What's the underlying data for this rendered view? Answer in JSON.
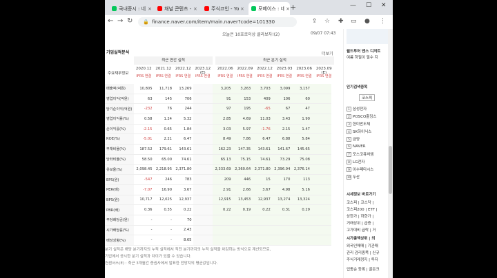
{
  "tabs": [
    {
      "title": "국내증시 : 네",
      "color": "#03c75a",
      "active": false
    },
    {
      "title": "채널 콘텐츠 -",
      "color": "#ff0000",
      "active": false
    },
    {
      "title": "주식코인 - Yo",
      "color": "#ff0000",
      "active": false
    },
    {
      "title": "모베이스 : 네",
      "color": "#03c75a",
      "active": true
    }
  ],
  "address": {
    "url": "finance.naver.com/item/main.naver?code=101330"
  },
  "ticker_bar": {
    "text": "오늘은 10호로이상 클라보자!(2)",
    "time": "09/07 07:43"
  },
  "section": {
    "title": "기업실적분석",
    "more": "더보기"
  },
  "table": {
    "header_main": "주요재무정보",
    "annual_title": "최근 연간 실적",
    "quarter_title": "최근 분기 실적",
    "annual_cols": [
      "2020.12",
      "2021.12",
      "2022.12",
      "2023.12 (E)"
    ],
    "quarter_cols": [
      "2022.06",
      "2022.09",
      "2022.12",
      "2023.03",
      "2023.06",
      "2023.09 (E)"
    ],
    "ifrs_label": "IFRS 연결",
    "rows": [
      {
        "label": "매출액(억원)",
        "a": [
          "10,805",
          "11,718",
          "13,269",
          ""
        ],
        "q": [
          "3,205",
          "3,263",
          "3,703",
          "3,099",
          "3,157",
          ""
        ]
      },
      {
        "label": "영업이익(억원)",
        "a": [
          "63",
          "145",
          "706",
          ""
        ],
        "q": [
          "91",
          "153",
          "409",
          "106",
          "60",
          ""
        ]
      },
      {
        "label": "당기순이익(억원)",
        "a": [
          "-232",
          "76",
          "244",
          ""
        ],
        "q": [
          "97",
          "195",
          "-65",
          "67",
          "47",
          ""
        ]
      },
      {
        "label": "영업이익률(%)",
        "a": [
          "0.58",
          "1.24",
          "5.32",
          ""
        ],
        "q": [
          "2.85",
          "4.69",
          "11.03",
          "3.43",
          "1.90",
          ""
        ]
      },
      {
        "label": "순이익률(%)",
        "a": [
          "-2.15",
          "0.65",
          "1.84",
          ""
        ],
        "q": [
          "3.03",
          "5.97",
          "-1.76",
          "2.15",
          "1.47",
          ""
        ]
      },
      {
        "label": "ROE(%)",
        "a": [
          "-5.01",
          "2.21",
          "6.47",
          ""
        ],
        "q": [
          "8.49",
          "7.86",
          "6.47",
          "6.88",
          "5.84",
          ""
        ]
      },
      {
        "label": "부채비율(%)",
        "a": [
          "187.52",
          "179.61",
          "143.61",
          ""
        ],
        "q": [
          "162.23",
          "147.35",
          "143.61",
          "141.67",
          "145.65",
          ""
        ]
      },
      {
        "label": "당좌비율(%)",
        "a": [
          "58.50",
          "65.00",
          "74.61",
          ""
        ],
        "q": [
          "65.13",
          "75.15",
          "74.61",
          "73.29",
          "75.08",
          ""
        ]
      },
      {
        "label": "유보율(%)",
        "a": [
          "2,098.45",
          "2,218.95",
          "2,371.80",
          ""
        ],
        "q": [
          "2,333.69",
          "2,360.64",
          "2,371.80",
          "2,396.94",
          "2,376.14",
          ""
        ]
      },
      {
        "label": "EPS(원)",
        "a": [
          "-547",
          "246",
          "783",
          ""
        ],
        "q": [
          "209",
          "446",
          "15",
          "170",
          "113",
          ""
        ]
      },
      {
        "label": "PER(배)",
        "a": [
          "-7.07",
          "16.90",
          "3.67",
          ""
        ],
        "q": [
          "2.91",
          "2.66",
          "3.67",
          "4.98",
          "5.16",
          ""
        ]
      },
      {
        "label": "BPS(원)",
        "a": [
          "10,717",
          "12,025",
          "12,937",
          ""
        ],
        "q": [
          "12,915",
          "13,453",
          "12,937",
          "13,274",
          "13,324",
          ""
        ]
      },
      {
        "label": "PBR(배)",
        "a": [
          "0.36",
          "0.35",
          "0.22",
          ""
        ],
        "q": [
          "0.22",
          "0.19",
          "0.22",
          "0.31",
          "0.29",
          ""
        ]
      },
      {
        "label": "주당배당금(원)",
        "a": [
          "-",
          "-",
          "70",
          ""
        ],
        "q": [
          "",
          "",
          "",
          "",
          "",
          ""
        ]
      },
      {
        "label": "시가배당률(%)",
        "a": [
          "-",
          "-",
          "2.43",
          ""
        ],
        "q": [
          "",
          "",
          "",
          "",
          "",
          ""
        ]
      },
      {
        "label": "배당성향(%)",
        "a": [
          "-",
          "-",
          "8.65",
          ""
        ],
        "q": [
          "",
          "",
          "",
          "",
          "",
          ""
        ]
      }
    ]
  },
  "footnotes": [
    "분기 실적은 해당 분기까지의 누적 실적에서 직전 분기까지의 누적 실적을 차감하는 방식으로 계산되므로,",
    "기업에서 공시한 분기 실적과 차이가 있을 수 있습니다.",
    "컨센서스(E) : 최근 3개월간 증권사에서 발표한 전망치의 평균값입니다."
  ],
  "right_panel": {
    "promo_lines": [
      "월드투어 앤스 디저트",
      "여름 하필이 필수 지"
    ],
    "popular_title": "인기검색종목",
    "market_tab": "코스피",
    "popular": [
      "삼성전자",
      "POSCO홀딩스",
      "한미반도체",
      "SK하이닉스",
      "금양",
      "NAVER",
      "포스코퓨처엠",
      "LG전자",
      "이수페타시스",
      "두산"
    ],
    "nav_title": "시세정보 바로가기",
    "nav_rows": [
      "코스피 | 코스닥 |",
      "코스피200 | ETF |",
      "상한가 | 하한가 |",
      "거래상위 | 급증 |",
      "고가대비 급락 | 거"
    ],
    "nav2_title": "시가총액상위 | 외",
    "nav2_rows": [
      "외국인매매 | 기관매",
      "관리 감리종목 | 신규",
      "주식거래정지 | 투자"
    ],
    "bottom": "업종순 등록 | 골든크"
  },
  "colors": {
    "negative": "#d04040",
    "ifrs": "#d04040",
    "quarter_bg": "#f4faf0"
  }
}
